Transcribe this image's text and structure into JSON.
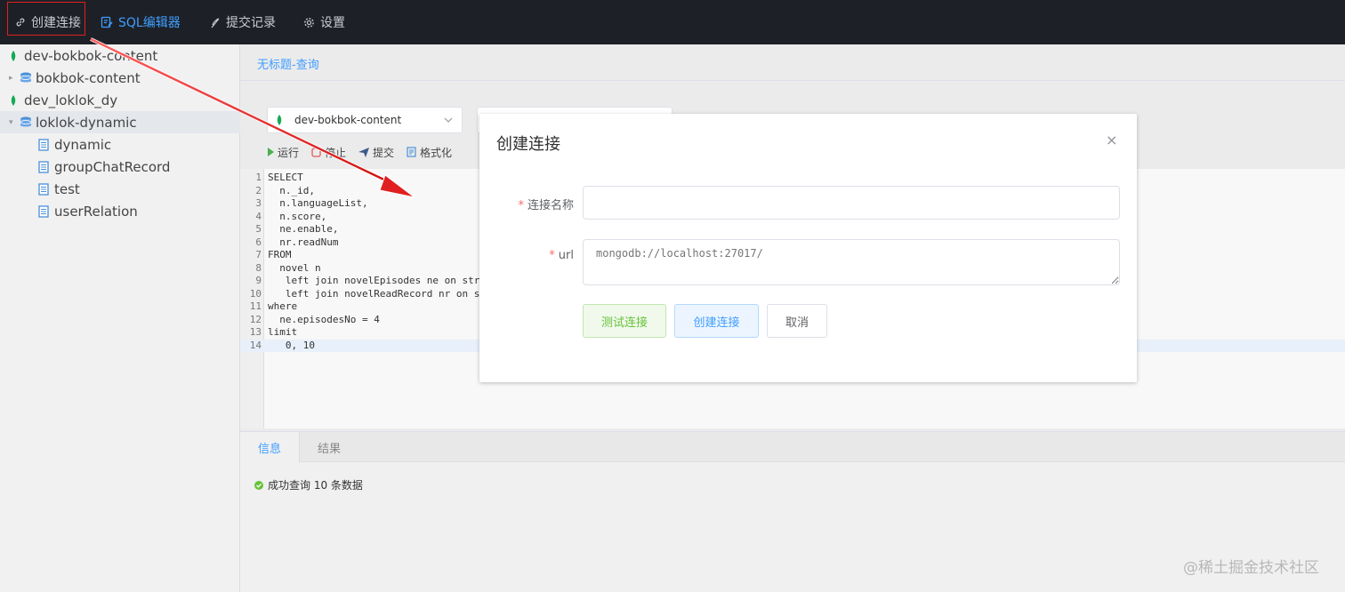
{
  "topbar": {
    "items": [
      {
        "label": "创建连接",
        "icon": "link-icon"
      },
      {
        "label": "SQL编辑器",
        "icon": "sql-editor-icon"
      },
      {
        "label": "提交记录",
        "icon": "quill-icon"
      },
      {
        "label": "设置",
        "icon": "gear-icon"
      }
    ]
  },
  "sidebar": {
    "tree": [
      {
        "label": "dev-bokbok-content",
        "icon": "mongodb-leaf-icon"
      },
      {
        "label": "bokbok-content",
        "icon": "database-icon",
        "caret": "▸"
      },
      {
        "label": "dev_loklok_dy",
        "icon": "mongodb-leaf-icon"
      },
      {
        "label": "loklok-dynamic",
        "icon": "database-icon",
        "caret": "▾"
      },
      {
        "label": "dynamic",
        "icon": "collection-icon"
      },
      {
        "label": "groupChatRecord",
        "icon": "collection-icon"
      },
      {
        "label": "test",
        "icon": "collection-icon"
      },
      {
        "label": "userRelation",
        "icon": "collection-icon"
      }
    ]
  },
  "main": {
    "tab_title": "无标题-查询",
    "connection_select": "dev-bokbok-content",
    "toolbar": {
      "run": "运行",
      "stop": "停止",
      "submit": "提交",
      "format": "格式化"
    },
    "code_lines": [
      {
        "n": "1",
        "text": "SELECT"
      },
      {
        "n": "2",
        "text": "  n._id,"
      },
      {
        "n": "3",
        "text": "  n.languageList,"
      },
      {
        "n": "4",
        "text": "  n.score,"
      },
      {
        "n": "5",
        "text": "  ne.enable,"
      },
      {
        "n": "6",
        "text": "  nr.readNum"
      },
      {
        "n": "7",
        "text": "FROM"
      },
      {
        "n": "8",
        "text": "  novel n"
      },
      {
        "n": "9",
        "text": "   left join novelEpisodes ne on str"
      },
      {
        "n": "10",
        "text": "   left join novelReadRecord nr on s"
      },
      {
        "n": "11",
        "text": "where"
      },
      {
        "n": "12",
        "text": "  ne.episodesNo = 4"
      },
      {
        "n": "13",
        "text": "limit"
      },
      {
        "n": "14",
        "text": "   0, 10"
      }
    ],
    "bottom_tabs": [
      "信息",
      "结果"
    ],
    "status_message": "成功查询 10 条数据"
  },
  "dialog": {
    "title": "创建连接",
    "close": "×",
    "name_label": "连接名称",
    "name_value": "",
    "url_label": "url",
    "url_placeholder": "mongodb://localhost:27017/",
    "required_mark": "*",
    "buttons": {
      "test": "测试连接",
      "create": "创建连接",
      "cancel": "取消"
    }
  },
  "watermark": "@稀土掘金技术社区",
  "colors": {
    "topbar_bg": "#1d2127",
    "accent": "#409eff",
    "success": "#67c23a",
    "highlight_box": "#e02020",
    "annotation_arrow": "#e02020"
  }
}
